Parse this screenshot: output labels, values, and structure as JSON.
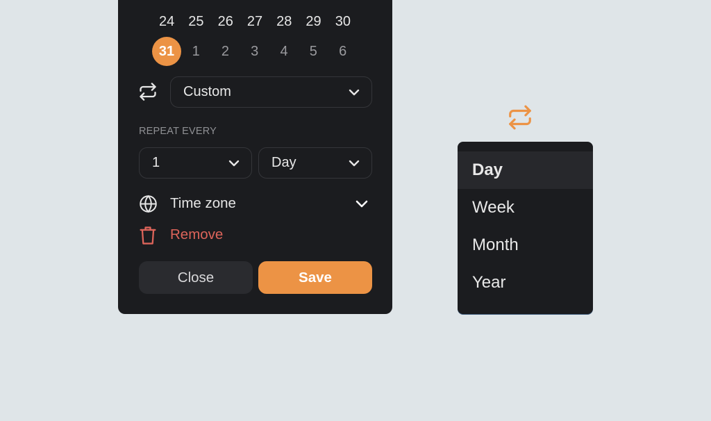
{
  "calendar": {
    "week_row_1": [
      "24",
      "25",
      "26",
      "27",
      "28",
      "29",
      "30"
    ],
    "week_row_2": [
      "31",
      "1",
      "2",
      "3",
      "4",
      "5",
      "6"
    ],
    "selected_day": "31",
    "accent_color": "#ec9345"
  },
  "repeat": {
    "icon": "repeat-icon",
    "selected": "Custom"
  },
  "repeat_every": {
    "label": "REPEAT EVERY",
    "interval_value": "1",
    "unit_value": "Day"
  },
  "timezone": {
    "icon": "globe-icon",
    "label": "Time zone"
  },
  "remove": {
    "icon": "trash-icon",
    "label": "Remove",
    "color": "#dd645a"
  },
  "buttons": {
    "close_label": "Close",
    "save_label": "Save"
  },
  "unit_dropdown": {
    "icon": "repeat-icon",
    "options": [
      "Day",
      "Week",
      "Month",
      "Year"
    ],
    "selected": "Day"
  }
}
